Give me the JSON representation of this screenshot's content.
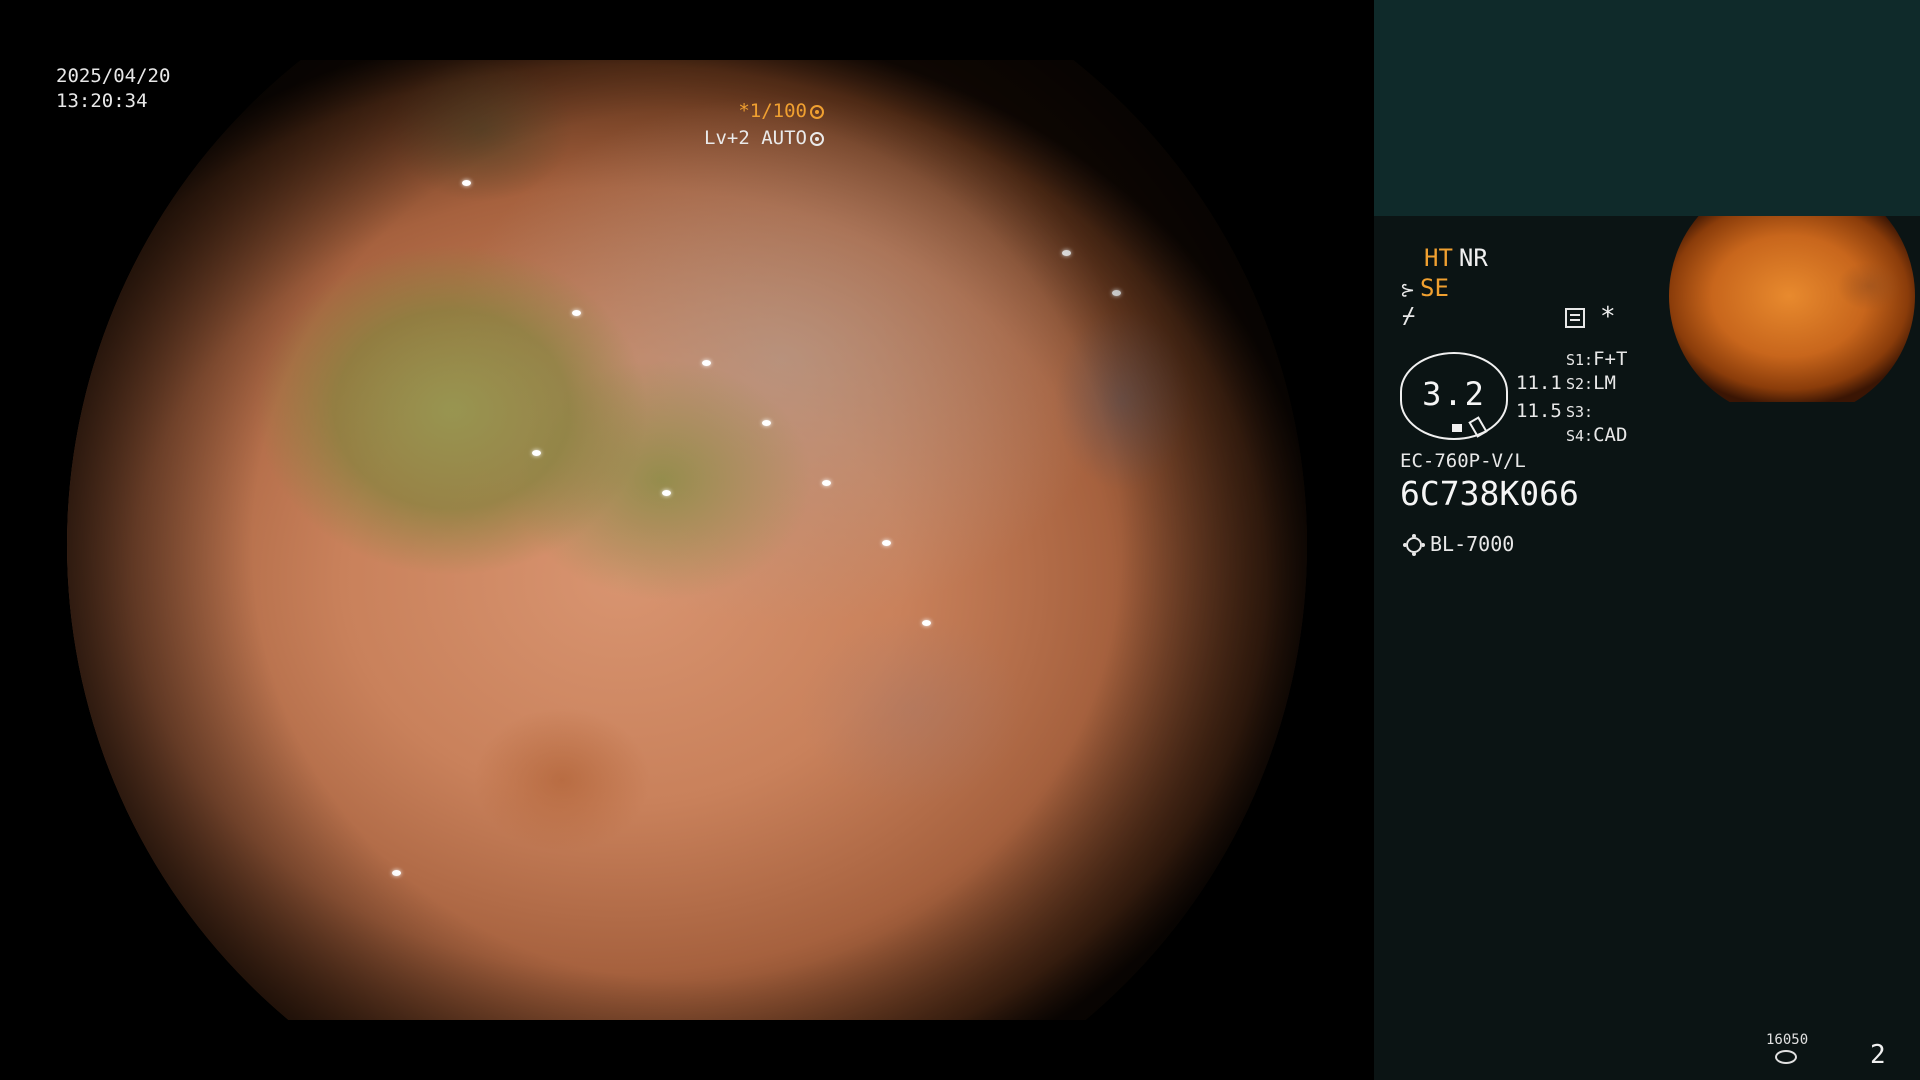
{
  "overlay": {
    "date": "2025/04/20",
    "time": "13:20:34",
    "shutter": "*1/100",
    "level": "Lv+2 AUTO"
  },
  "panel": {
    "mode_ht": "HT",
    "mode_nr": "NR",
    "mode_se": "SE",
    "zoom": "3.2",
    "value1": "11.1",
    "value2": "11.5",
    "s_keys": [
      "S1:",
      "S2:",
      "S3:",
      "S4:"
    ],
    "s_values": [
      "F+T",
      "LM",
      "",
      "CAD"
    ],
    "scope_model": "EC-760P-V/L",
    "serial": "6C738K066",
    "light_source": "BL-7000",
    "counter": "16050",
    "page_number": "2"
  },
  "colors": {
    "accent_orange": "#f0a030",
    "panel_bg": "#0b1414",
    "panel_header_bg": "#0f2a2a"
  },
  "icons": [
    "dial-icon",
    "scope-icon",
    "menu-icon",
    "star-icon",
    "sun-icon",
    "disk-icon"
  ]
}
